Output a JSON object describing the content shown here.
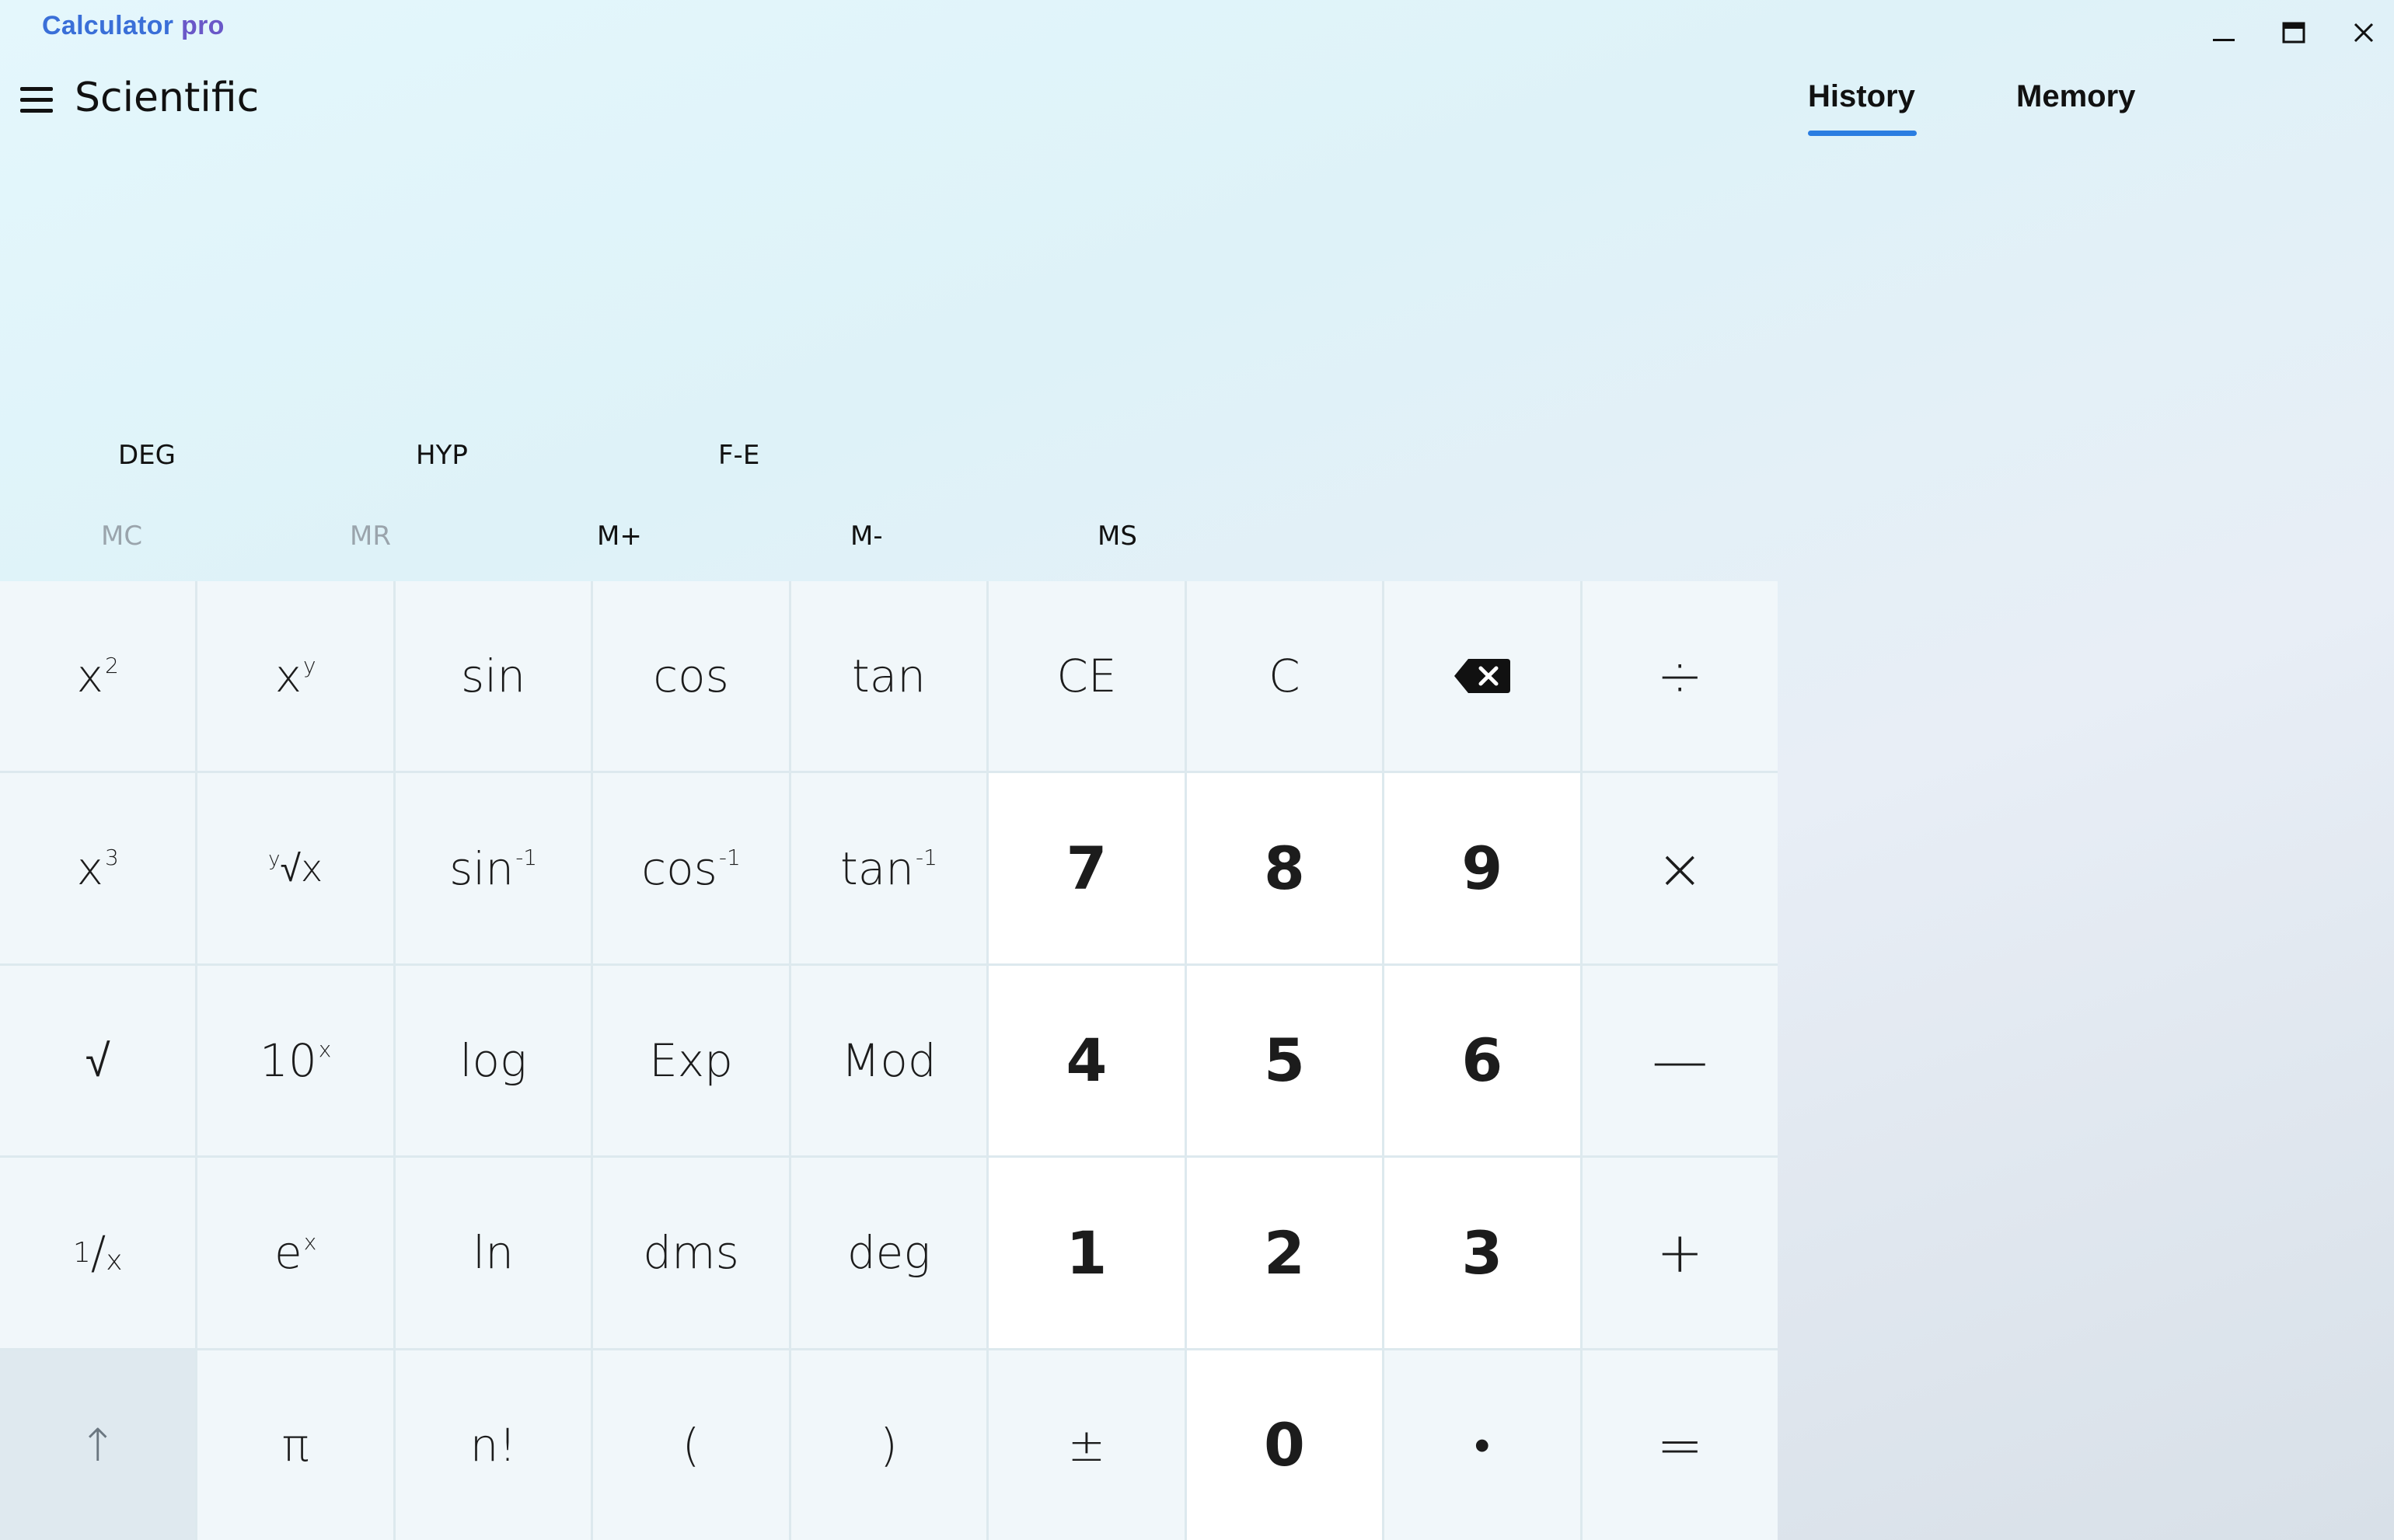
{
  "app": {
    "title_part1": "Calculator",
    "title_part2": "pro"
  },
  "header": {
    "mode": "Scientific"
  },
  "panel_tabs": [
    {
      "label": "History",
      "active": true
    },
    {
      "label": "Memory",
      "active": false
    }
  ],
  "toggles": [
    "DEG",
    "HYP",
    "F-E"
  ],
  "memory_buttons": [
    {
      "label": "MC",
      "enabled": false
    },
    {
      "label": "MR",
      "enabled": false
    },
    {
      "label": "M+",
      "enabled": true
    },
    {
      "label": "M-",
      "enabled": true
    },
    {
      "label": "MS",
      "enabled": true
    }
  ],
  "keys": {
    "r1": {
      "x_squared": "x",
      "x_squared_sup": "2",
      "x_pow_y": "x",
      "x_pow_y_sup": "y",
      "sin": "sin",
      "cos": "cos",
      "tan": "tan",
      "ce": "CE",
      "c": "C",
      "divide": "÷"
    },
    "r2": {
      "x_cubed": "x",
      "x_cubed_sup": "3",
      "root_y_pre": "y",
      "root_y": "√x",
      "asin": "sin",
      "asin_sup": "-1",
      "acos": "cos",
      "acos_sup": "-1",
      "atan": "tan",
      "atan_sup": "-1",
      "seven": "7",
      "eight": "8",
      "nine": "9",
      "multiply": "×"
    },
    "r3": {
      "sqrt": "√",
      "ten_pow": "10",
      "ten_pow_sup": "x",
      "log": "log",
      "exp": "Exp",
      "mod": "Mod",
      "four": "4",
      "five": "5",
      "six": "6",
      "minus": "—"
    },
    "r4": {
      "recip_1": "1",
      "recip_slash": "/",
      "recip_x": "x",
      "e_pow": "e",
      "e_pow_sup": "x",
      "ln": "ln",
      "dms": "dms",
      "deg": "deg",
      "one": "1",
      "two": "2",
      "three": "3",
      "plus": "+"
    },
    "r5": {
      "shift": "↑",
      "pi": "π",
      "factorial": "n!",
      "lparen": "(",
      "rparen": ")",
      "plusminus": "±",
      "zero": "0",
      "decimal": "•",
      "equals": "="
    }
  },
  "colors": {
    "accent": "#2a7de1",
    "title_blue": "#3a6fd8",
    "title_red": "#d12b3e",
    "title_purple": "#6a58c8"
  }
}
